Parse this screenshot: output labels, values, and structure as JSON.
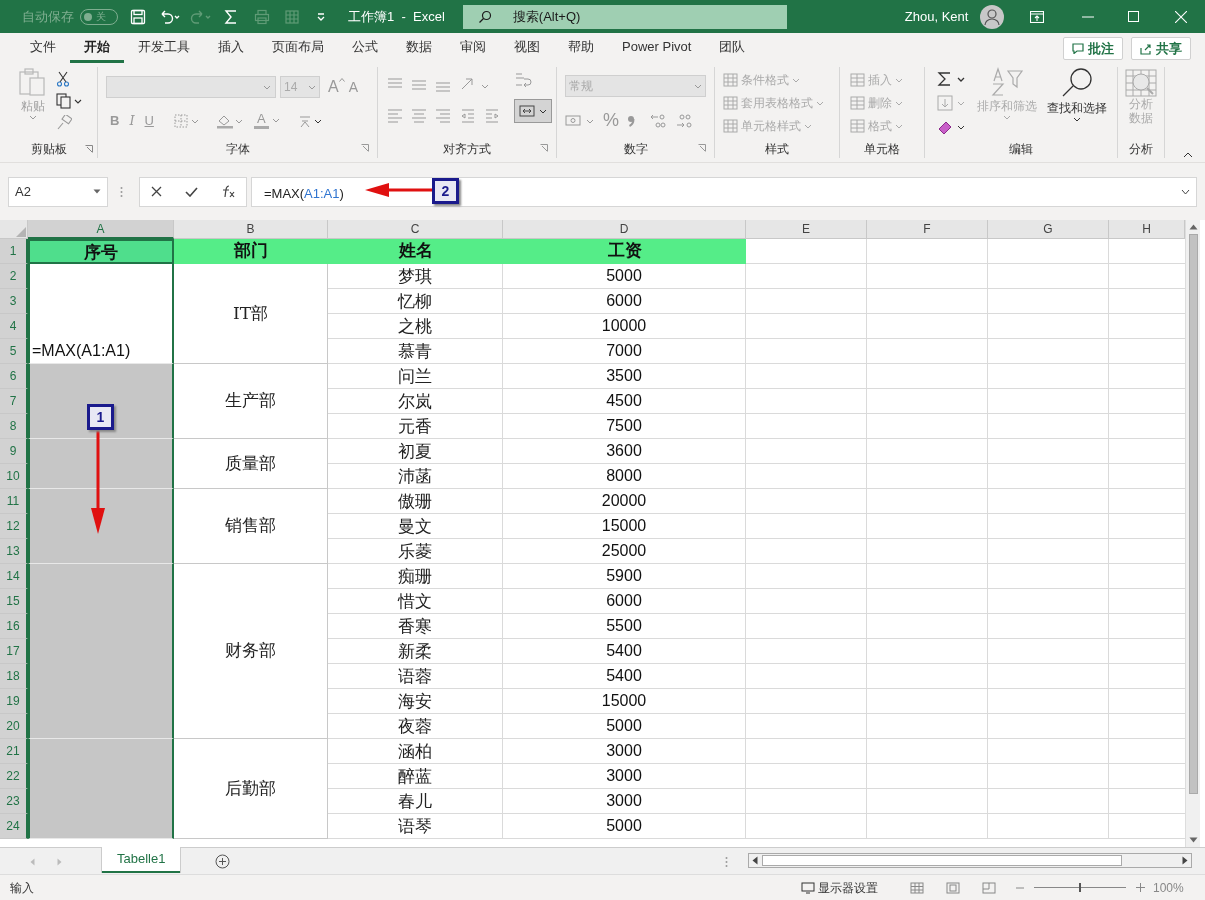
{
  "title_bar": {
    "autosave_label": "自动保存",
    "autosave_toggle": {
      "label": "关",
      "on": false
    },
    "title": "工作簿1  -  Excel",
    "search": {
      "placeholder": "搜索(Alt+Q)"
    },
    "user": "Zhou, Kent"
  },
  "menu_tabs": [
    {
      "label": "文件",
      "selected": false
    },
    {
      "label": "开始",
      "selected": true
    },
    {
      "label": "开发工具",
      "selected": false
    },
    {
      "label": "插入",
      "selected": false
    },
    {
      "label": "页面布局",
      "selected": false
    },
    {
      "label": "公式",
      "selected": false
    },
    {
      "label": "数据",
      "selected": false
    },
    {
      "label": "审阅",
      "selected": false
    },
    {
      "label": "视图",
      "selected": false
    },
    {
      "label": "帮助",
      "selected": false
    },
    {
      "label": "Power Pivot",
      "selected": false
    },
    {
      "label": "团队",
      "selected": false
    }
  ],
  "top_buttons": [
    "批注",
    "共享"
  ],
  "ribbon": {
    "clipboard": {
      "paste": "粘贴",
      "label": "剪贴板"
    },
    "font": {
      "size": "14",
      "grow": "A",
      "shrink": "A",
      "bold": "B",
      "italic": "I",
      "underline": "U",
      "font_color": "A",
      "label": "字体"
    },
    "alignment": {
      "label": "对齐方式"
    },
    "number": {
      "format": "常规",
      "percent": "%",
      "label": "数字"
    },
    "styles": {
      "items": [
        "条件格式",
        "套用表格格式",
        "单元格样式"
      ],
      "label": "样式"
    },
    "cells": {
      "items": [
        "插入",
        "删除",
        "格式"
      ],
      "label": "单元格"
    },
    "editing": {
      "sort": "排序和筛选",
      "find": "查找和选择",
      "label": "编辑"
    },
    "analysis": {
      "button": "分析数据",
      "label": "分析"
    }
  },
  "formula_bar": {
    "name_box": "A2",
    "formula": [
      {
        "text": "=MAX(",
        "kind": "plain"
      },
      {
        "text": "A1:A1",
        "kind": "ref"
      },
      {
        "text": ")",
        "kind": "plain"
      }
    ]
  },
  "sheet": {
    "columns": [
      "A",
      "B",
      "C",
      "D",
      "E",
      "F",
      "G",
      "H"
    ],
    "row_numbers": [
      "1",
      "2",
      "3",
      "4",
      "5",
      "6",
      "7",
      "8",
      "9",
      "10",
      "11",
      "12",
      "13",
      "14",
      "15",
      "16",
      "17",
      "18",
      "19",
      "20",
      "21",
      "22",
      "23",
      "24"
    ],
    "header": [
      "序号",
      "部门",
      "姓名",
      "工资"
    ],
    "departments": [
      {
        "name": "IT部",
        "seq_text": "=MAX(A1:A1)",
        "seq_shaded": false,
        "employees": [
          {
            "name": "梦琪",
            "salary": "5000"
          },
          {
            "name": "忆柳",
            "salary": "6000"
          },
          {
            "name": "之桃",
            "salary": "10000"
          },
          {
            "name": "慕青",
            "salary": "7000"
          }
        ]
      },
      {
        "name": "生产部",
        "seq_shaded": true,
        "employees": [
          {
            "name": "问兰",
            "salary": "3500"
          },
          {
            "name": "尔岚",
            "salary": "4500"
          },
          {
            "name": "元香",
            "salary": "7500"
          }
        ]
      },
      {
        "name": "质量部",
        "seq_shaded": true,
        "employees": [
          {
            "name": "初夏",
            "salary": "3600"
          },
          {
            "name": "沛菡",
            "salary": "8000"
          }
        ]
      },
      {
        "name": "销售部",
        "seq_shaded": true,
        "employees": [
          {
            "name": "傲珊",
            "salary": "20000"
          },
          {
            "name": "曼文",
            "salary": "15000"
          },
          {
            "name": "乐菱",
            "salary": "25000"
          }
        ]
      },
      {
        "name": "财务部",
        "seq_shaded": true,
        "employees": [
          {
            "name": "痴珊",
            "salary": "5900"
          },
          {
            "name": "惜文",
            "salary": "6000"
          },
          {
            "name": "香寒",
            "salary": "5500"
          },
          {
            "name": "新柔",
            "salary": "5400"
          },
          {
            "name": "语蓉",
            "salary": "5400"
          },
          {
            "name": "海安",
            "salary": "15000"
          },
          {
            "name": "夜蓉",
            "salary": "5000"
          }
        ]
      },
      {
        "name": "后勤部",
        "seq_shaded": true,
        "employees": [
          {
            "name": "涵柏",
            "salary": "3000"
          },
          {
            "name": "醉蓝",
            "salary": "3000"
          },
          {
            "name": "春儿",
            "salary": "3000"
          },
          {
            "name": "语琴",
            "salary": "5000"
          }
        ]
      }
    ]
  },
  "sheet_tabs": [
    {
      "label": "Tabelle1",
      "selected": true
    }
  ],
  "status_bar": {
    "mode": "输入",
    "display_settings": "显示器设置",
    "zoom_slider": {
      "level": 0.5
    },
    "zoom": "100%"
  },
  "annotations": [
    {
      "label": "1"
    },
    {
      "label": "2"
    }
  ]
}
